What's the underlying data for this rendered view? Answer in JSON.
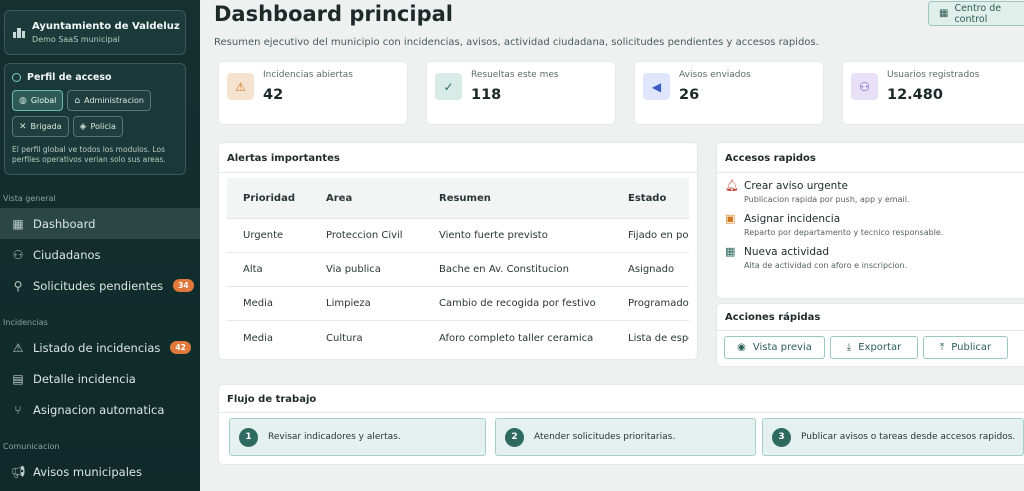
{
  "sidebar": {
    "org": {
      "name": "Ayuntamiento de Valdeluz",
      "subtitle": "Demo SaaS municipal"
    },
    "profile": {
      "title": "Perfil de acceso",
      "chips": [
        {
          "label": "Global",
          "icon": "globe-icon",
          "active": true
        },
        {
          "label": "Administracion",
          "icon": "bank-icon",
          "active": false
        },
        {
          "label": "Brigada",
          "icon": "tools-icon",
          "active": false
        },
        {
          "label": "Policia",
          "icon": "shield-icon",
          "active": false
        }
      ],
      "note": "El perfil global ve todos los modulos. Los perfiles operativos verian solo sus areas."
    },
    "sections": [
      {
        "label": "Vista general"
      },
      {
        "label": "Incidencias"
      },
      {
        "label": "Comunicacion"
      }
    ],
    "items": [
      {
        "label": "Dashboard",
        "icon": "grid-icon",
        "active": true,
        "badge": ""
      },
      {
        "label": "Ciudadanos",
        "icon": "people-icon",
        "badge": ""
      },
      {
        "label": "Solicitudes pendientes",
        "icon": "search-person-icon",
        "badge": "34"
      },
      {
        "label": "Listado de incidencias",
        "icon": "warning-icon",
        "badge": "42"
      },
      {
        "label": "Detalle incidencia",
        "icon": "clipboard-icon",
        "badge": ""
      },
      {
        "label": "Asignacion automatica",
        "icon": "route-icon",
        "badge": ""
      },
      {
        "label": "Avisos municipales",
        "icon": "megaphone-icon",
        "badge": ""
      }
    ]
  },
  "header": {
    "title": "Dashboard principal",
    "subtitle": "Resumen ejecutivo del municipio con incidencias, avisos, actividad ciudadana, solicitudes pendientes y accesos rapidos.",
    "control_label": "Centro de control"
  },
  "stats": [
    {
      "label": "Incidencias abiertas",
      "value": "42",
      "icon": "warning-icon",
      "color": "#f6e3cf"
    },
    {
      "label": "Resueltas este mes",
      "value": "118",
      "icon": "check-circle-icon",
      "color": "#d9ebe7"
    },
    {
      "label": "Avisos enviados",
      "value": "26",
      "icon": "megaphone-icon",
      "color": "#dfe6fb"
    },
    {
      "label": "Usuarios registrados",
      "value": "12.480",
      "icon": "users-icon",
      "color": "#e8e0f7"
    }
  ],
  "alerts": {
    "title": "Alertas importantes",
    "columns": [
      "Prioridad",
      "Area",
      "Resumen",
      "Estado"
    ],
    "rows": [
      [
        "Urgente",
        "Proteccion Civil",
        "Viento fuerte previsto",
        "Fijado en portada"
      ],
      [
        "Alta",
        "Via publica",
        "Bache en Av. Constitucion",
        "Asignado"
      ],
      [
        "Media",
        "Limpieza",
        "Cambio de recogida por festivo",
        "Programado"
      ],
      [
        "Media",
        "Cultura",
        "Aforo completo taller ceramica",
        "Lista de espera"
      ]
    ]
  },
  "access": {
    "title": "Accesos rapidos",
    "items": [
      {
        "title": "Crear aviso urgente",
        "desc": "Publicacion rapida por push, app y email.",
        "icon": "bell-icon",
        "color": "#c0392b"
      },
      {
        "title": "Asignar incidencia",
        "desc": "Reparto por departamento y tecnico responsable.",
        "icon": "user-badge-icon",
        "color": "#d4781f"
      },
      {
        "title": "Nueva actividad",
        "desc": "Alta de actividad con aforo e inscripcion.",
        "icon": "calendar-icon",
        "color": "#2f6a60"
      }
    ]
  },
  "quick_actions": {
    "title": "Acciones rápidas",
    "buttons": [
      {
        "label": "Vista previa",
        "icon": "eye-icon"
      },
      {
        "label": "Exportar",
        "icon": "download-icon"
      },
      {
        "label": "Publicar",
        "icon": "upload-icon"
      }
    ]
  },
  "workflow": {
    "title": "Flujo de trabajo",
    "steps": [
      {
        "num": "1",
        "text": "Revisar indicadores y alertas."
      },
      {
        "num": "2",
        "text": "Atender solicitudes prioritarias."
      },
      {
        "num": "3",
        "text": "Publicar avisos o tareas desde accesos rapidos."
      }
    ]
  }
}
